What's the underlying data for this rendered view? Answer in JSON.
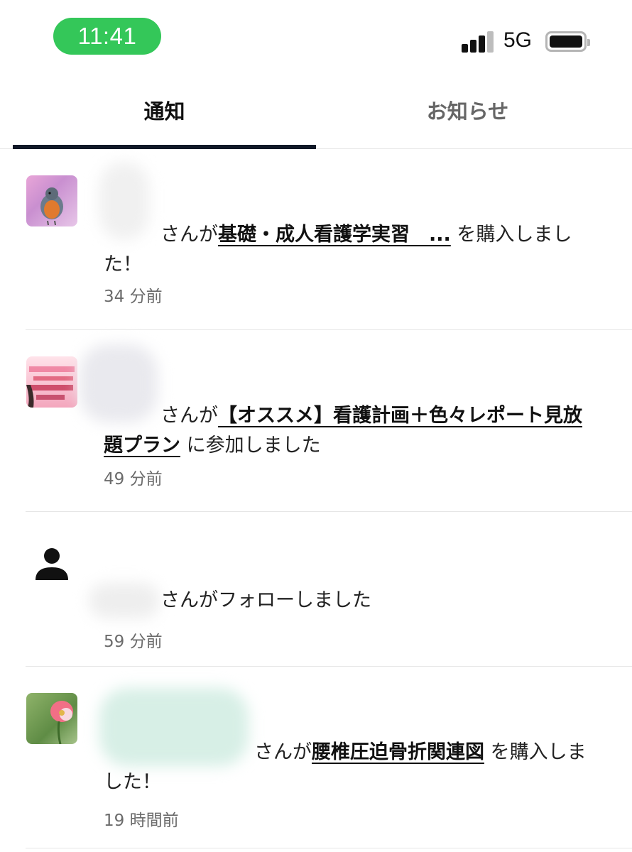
{
  "status_bar": {
    "time": "11:41",
    "network": "5G",
    "battery_level": 1.0,
    "time_pill_color": "#34c759"
  },
  "tabs": [
    {
      "label": "通知",
      "active": true
    },
    {
      "label": "お知らせ",
      "active": false
    }
  ],
  "notifications": [
    {
      "avatar": "robin-bird-photo",
      "prefix": "さんが",
      "link": "基礎・成人看護学実習　...",
      "suffix": " を購入しました！",
      "time": "34 分前"
    },
    {
      "avatar": "pink-plan-banner",
      "prefix": "さんが",
      "link": "【オススメ】看護計画＋色々レポート見放題プラン",
      "suffix": " に参加しました",
      "time": "49 分前"
    },
    {
      "avatar": "person-icon",
      "prefix": "さんがフォローしました",
      "link": "",
      "suffix": "",
      "time": "59 分前"
    },
    {
      "avatar": "pink-flower-photo",
      "prefix": "さんが",
      "link": "腰椎圧迫骨折関連図",
      "suffix": " を購入しました！",
      "time": "19 時間前"
    }
  ]
}
